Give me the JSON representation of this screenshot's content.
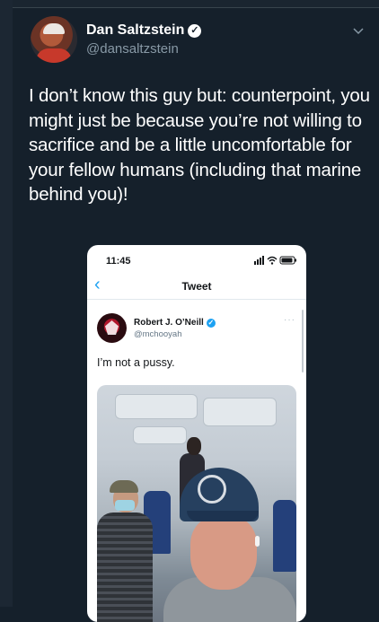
{
  "tweet": {
    "display_name": "Dan Saltzstein",
    "handle": "@dansaltzstein",
    "verified_glyph": "✓",
    "text": "I don’t know this guy but: counterpoint, you might just be because you’re not willing to sacrifice and be a little uncomfortable for your fellow humans (including that marine behind you)!"
  },
  "embedded": {
    "status_time": "11:45",
    "nav_back": "‹",
    "nav_title": "Tweet",
    "author_name": "Robert J. O’Neill",
    "author_handle": "@mchooyah",
    "author_verified_glyph": "✓",
    "more_glyph": "···",
    "text": "I’m not a pussy."
  },
  "colors": {
    "background": "#15202b",
    "secondary_text": "#8899a6",
    "accent": "#1da1f2"
  },
  "icons": [
    "verified-icon",
    "chevron-down-icon",
    "back-icon",
    "signal-icon",
    "wifi-icon",
    "battery-icon",
    "more-icon"
  ]
}
